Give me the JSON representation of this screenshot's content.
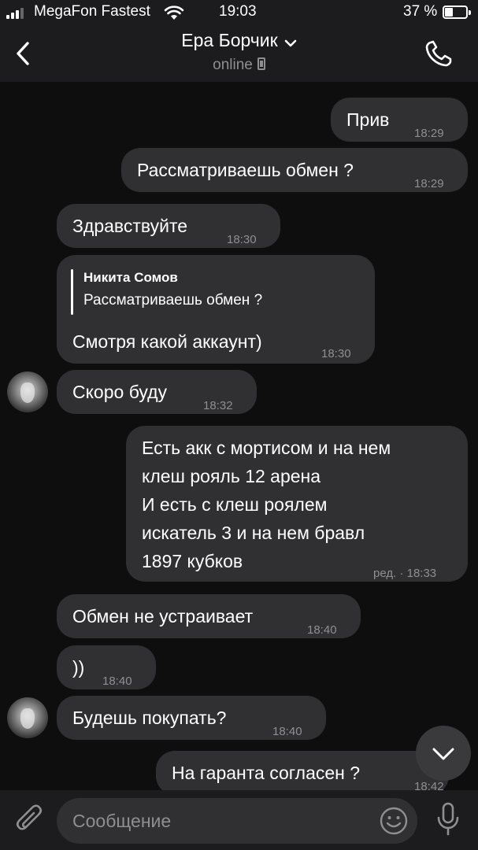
{
  "status_bar": {
    "carrier": "MegaFon Fastest",
    "time": "19:03",
    "battery_percent": "37 %",
    "battery_level": 0.37
  },
  "header": {
    "title": "Ера Борчик",
    "subtitle": "online",
    "icons": {
      "back": "chevron-left-icon",
      "dropdown": "chevron-down-icon",
      "device": "phone-device-icon",
      "call": "phone-call-icon"
    }
  },
  "messages": [
    {
      "side": "out",
      "text": "Прив",
      "time": "18:29"
    },
    {
      "side": "out",
      "text": "Рассматриваешь обмен ?",
      "time": "18:29"
    },
    {
      "side": "in",
      "text": "Здравствуйте",
      "time": "18:30"
    },
    {
      "side": "in",
      "reply_name": "Никита Сомов",
      "reply_text": "Рассматриваешь обмен ?",
      "text": "Смотря какой аккаунт)",
      "time": "18:30"
    },
    {
      "side": "in",
      "text": "Скоро буду",
      "time": "18:32"
    },
    {
      "side": "out",
      "lines": [
        "Есть акк с мортисом и на нем",
        "клеш рояль 12 арена",
        "И есть с клеш роялем",
        "искатель 3 и на нем бравл",
        "1897 кубков"
      ],
      "time": "ред. · 18:33"
    },
    {
      "side": "in",
      "text": "Обмен не устраивает",
      "time": "18:40"
    },
    {
      "side": "in",
      "text": "))",
      "time": "18:40"
    },
    {
      "side": "in",
      "text": "Будешь покупать?",
      "time": "18:40"
    },
    {
      "side": "out",
      "text": "На гаранта согласен ?",
      "time": "18:42"
    }
  ],
  "input_bar": {
    "placeholder": "Сообщение",
    "icons": {
      "attach": "paperclip-icon",
      "emoji": "emoji-icon",
      "mic": "microphone-icon"
    }
  },
  "scroll_button_icon": "chevron-down-icon"
}
